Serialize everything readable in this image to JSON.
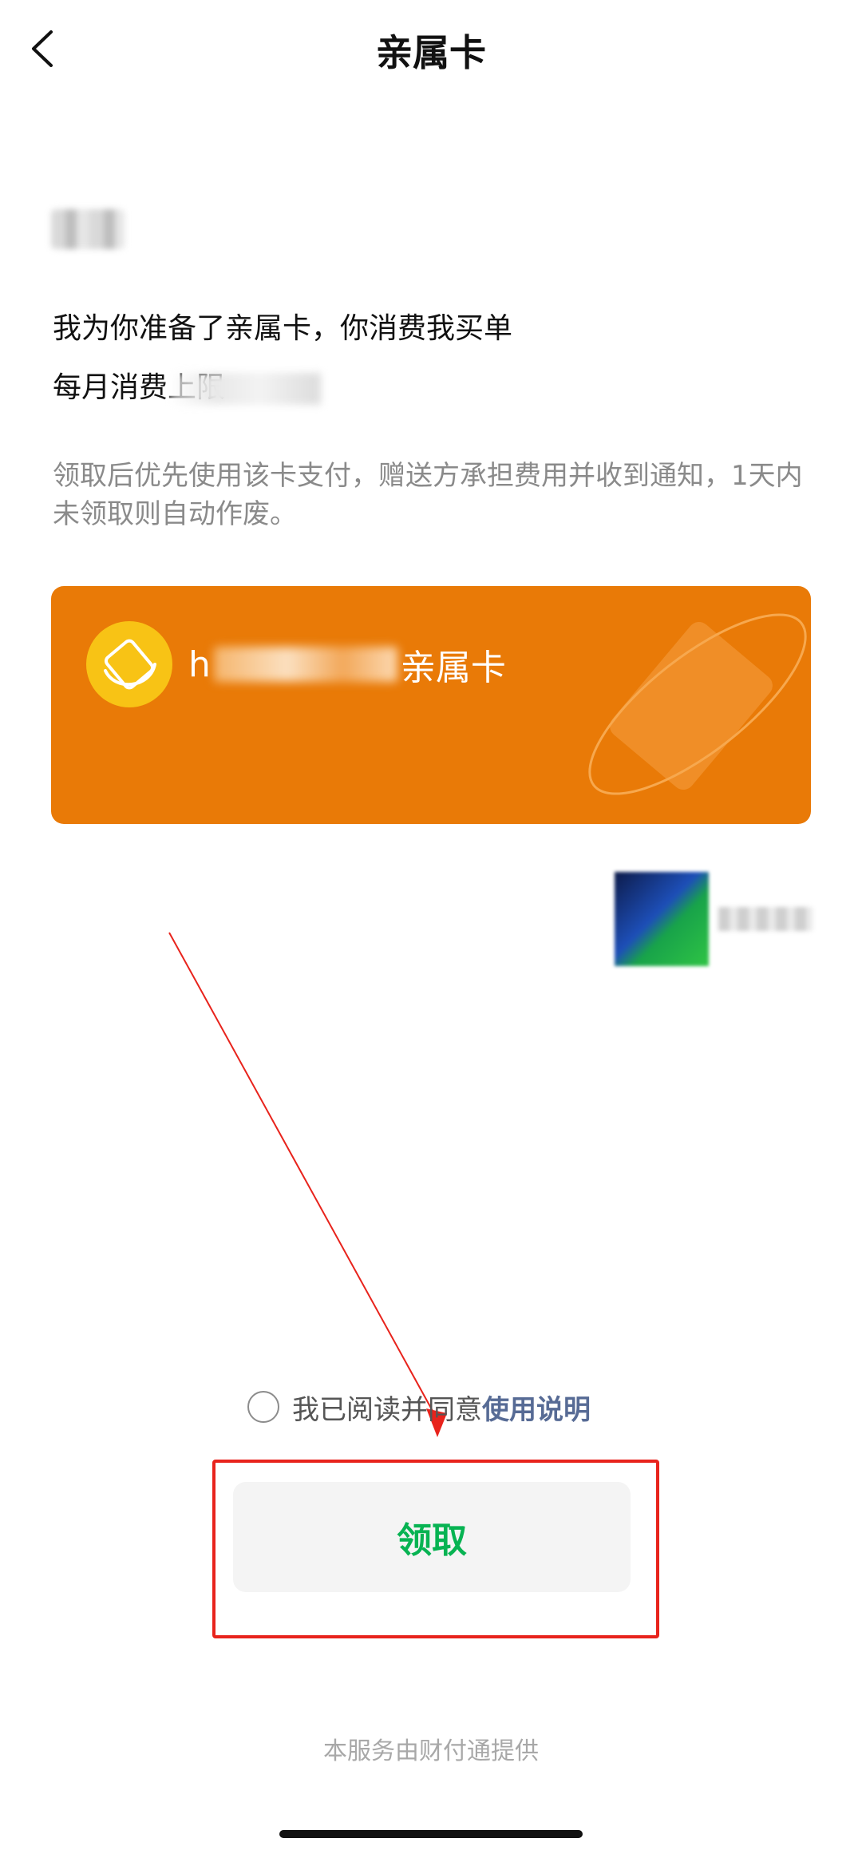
{
  "nav": {
    "title": "亲属卡",
    "back_icon": "chevron-left-icon"
  },
  "message": {
    "line1": "我为你准备了亲属卡，你消费我买单",
    "line2_prefix": "每月消费上限"
  },
  "notice": "领取后优先使用该卡支付，赠送方承担费用并收到通知，1天内未领取则自动作废。",
  "card": {
    "title_prefix": "h",
    "title_suffix": "亲属卡",
    "background_color": "#e97a07",
    "logo_color": "#f8c315",
    "logo_icon": "family-card-icon"
  },
  "agreement": {
    "text": "我已阅读并同意",
    "link": "使用说明",
    "checked": false
  },
  "claim_button": {
    "label": "领取",
    "color": "#07b352"
  },
  "footer": "本服务由财付通提供",
  "annotation": {
    "color": "#e8231c"
  }
}
